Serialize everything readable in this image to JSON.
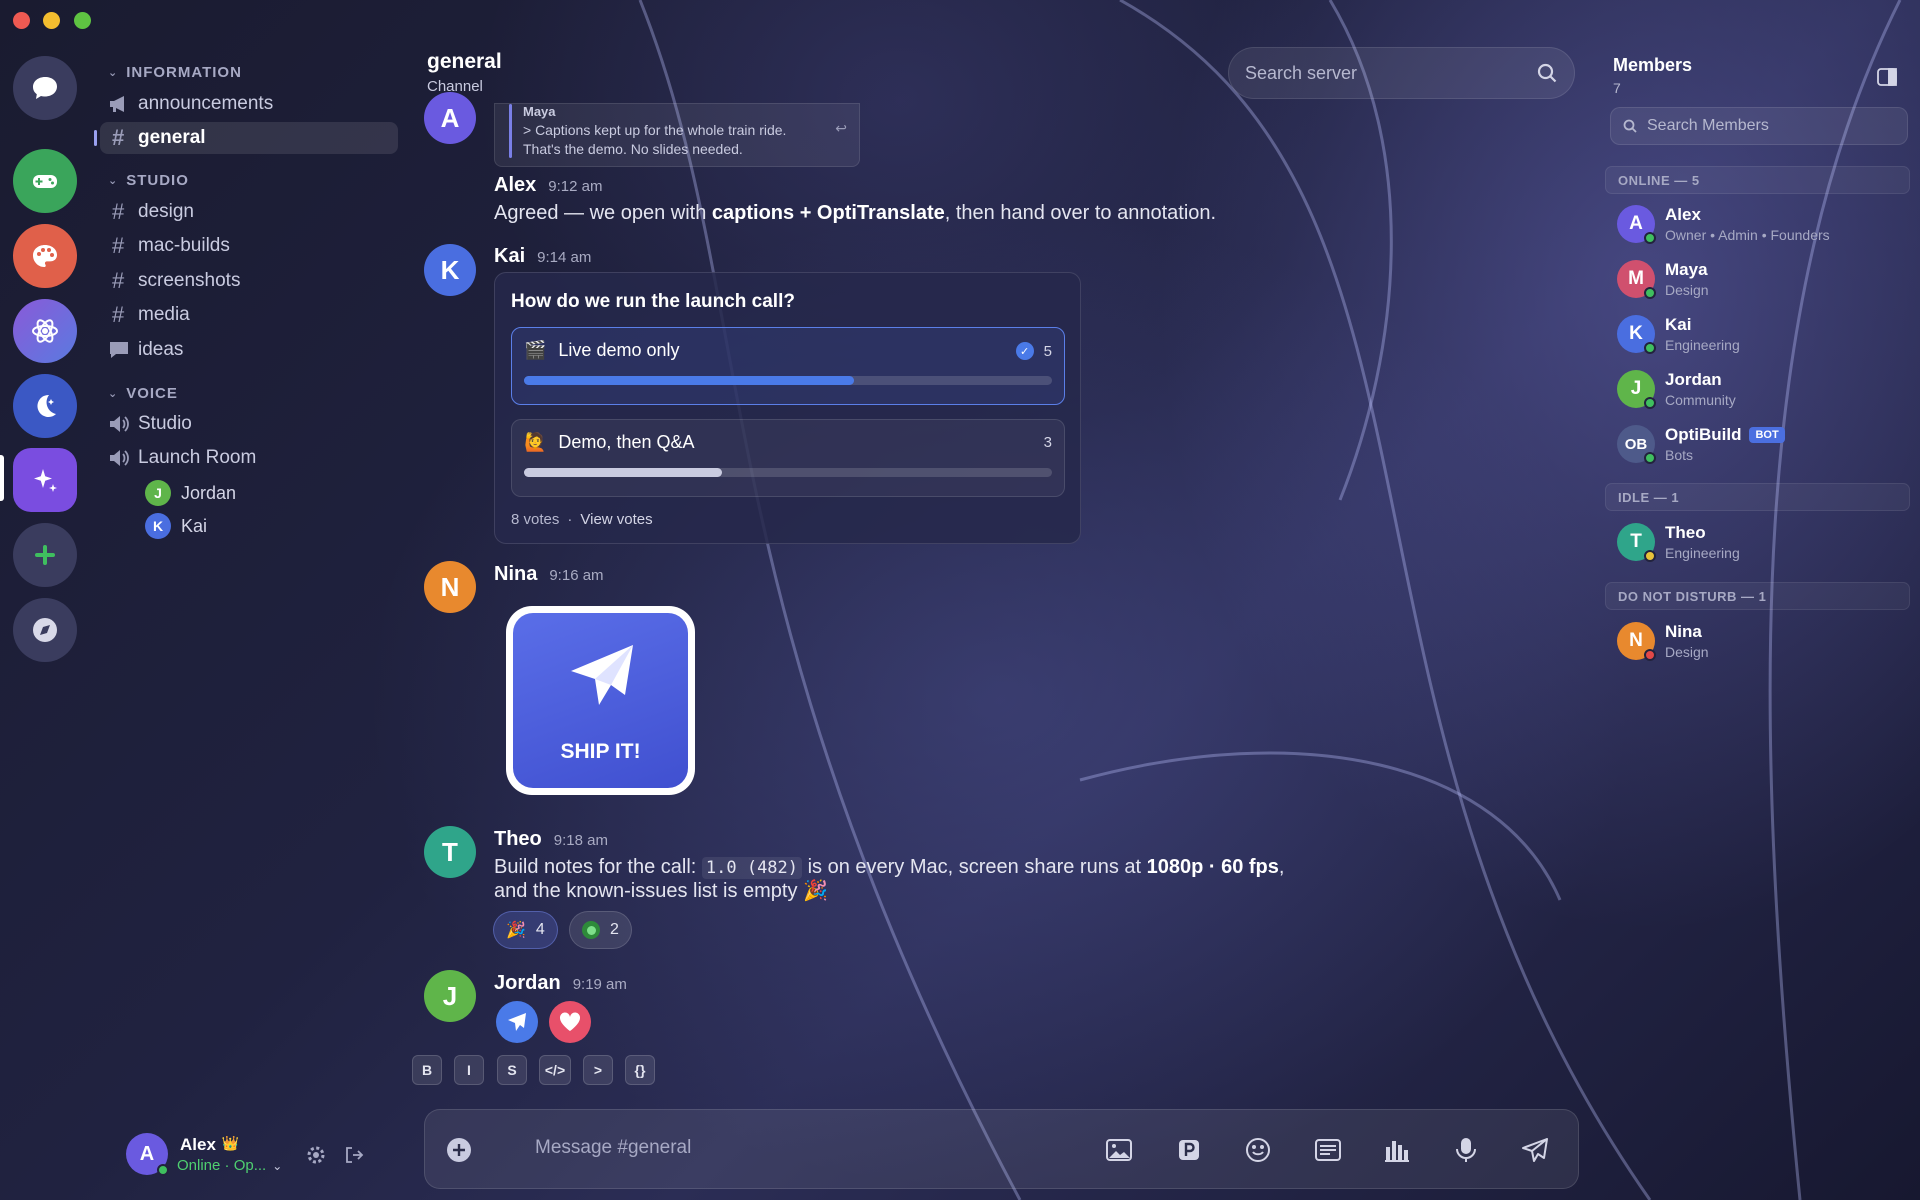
{
  "channel_list": {
    "sections": [
      {
        "label": "INFORMATION"
      },
      {
        "label": "STUDIO"
      },
      {
        "label": "VOICE"
      }
    ],
    "info_channels": [
      "announcements",
      "general"
    ],
    "studio_channels": [
      "design",
      "mac-builds",
      "screenshots",
      "media",
      "ideas"
    ],
    "voice_channels": [
      "Studio",
      "Launch Room"
    ],
    "voice_users": [
      {
        "initial": "J",
        "name": "Jordan",
        "color": "#5fb54a"
      },
      {
        "initial": "K",
        "name": "Kai",
        "color": "#4a6ee0"
      }
    ]
  },
  "user_panel": {
    "initial": "A",
    "name": "Alex",
    "status": "Online · Op...",
    "crown": "👑"
  },
  "header": {
    "title": "general",
    "subtitle": "Channel",
    "search_placeholder": "Search server"
  },
  "messages": {
    "quote": {
      "initial": "A",
      "author": "Maya",
      "line1": "> Captions kept up for the whole train ride.",
      "line2": "That's the demo. No slides needed."
    },
    "alex": {
      "name": "Alex",
      "time": "9:12 am",
      "text_pre": "Agreed — we open with ",
      "text_bold": "captions + OptiTranslate",
      "text_post": ", then hand over to annotation."
    },
    "kai": {
      "initial": "K",
      "name": "Kai",
      "time": "9:14 am"
    },
    "poll": {
      "question": "How do we run the launch call?",
      "options": [
        {
          "emoji": "🎬",
          "label": "Live demo only",
          "count": "5",
          "fraction": 0.625
        },
        {
          "emoji": "🙋",
          "label": "Demo, then Q&A",
          "count": "3",
          "fraction": 0.375
        }
      ],
      "votes": "8 votes",
      "sep": "·",
      "view": "View votes"
    },
    "nina": {
      "initial": "N",
      "name": "Nina",
      "time": "9:16 am",
      "sticker_text": "SHIP IT!"
    },
    "theo": {
      "initial": "T",
      "name": "Theo",
      "time": "9:18 am",
      "t1": "Build notes for the call: ",
      "code": "1.0 (482)",
      "t2": " is on every Mac, screen share runs at ",
      "bold": "1080p · 60 fps",
      "t3": ",",
      "line2": "and the known-issues list is empty 🎉",
      "reactions": [
        {
          "emoji": "🎉",
          "count": "4"
        },
        {
          "emoji": "🟢",
          "count": "2"
        }
      ]
    },
    "jordan": {
      "initial": "J",
      "name": "Jordan",
      "time": "9:19 am"
    }
  },
  "format_bar": [
    "B",
    "I",
    "S",
    "</>",
    ">",
    "{}"
  ],
  "composer": {
    "placeholder": "Message #general"
  },
  "members": {
    "title": "Members",
    "count": "7",
    "search_placeholder": "Search Members",
    "groups": [
      {
        "label": "ONLINE — 5"
      },
      {
        "label": "IDLE — 1"
      },
      {
        "label": "DO NOT DISTURB — 1"
      }
    ],
    "list": [
      {
        "initial": "A",
        "name": "Alex",
        "role": "Owner • Admin • Founders",
        "color": "#6a5ae0",
        "status": "#3fbf5f"
      },
      {
        "initial": "M",
        "name": "Maya",
        "role": "Design",
        "color": "#d0506e",
        "status": "#3fbf5f"
      },
      {
        "initial": "K",
        "name": "Kai",
        "role": "Engineering",
        "color": "#4a6ee0",
        "status": "#3fbf5f"
      },
      {
        "initial": "J",
        "name": "Jordan",
        "role": "Community",
        "color": "#5fb54a",
        "status": "#3fbf5f"
      },
      {
        "initial": "OB",
        "name": "OptiBuild",
        "role": "Bots",
        "color": "#4e5a8a",
        "status": "#3fbf5f",
        "badge": "BOT"
      },
      {
        "initial": "T",
        "name": "Theo",
        "role": "Engineering",
        "color": "#2fa58a",
        "status": "#e8c23a"
      },
      {
        "initial": "N",
        "name": "Nina",
        "role": "Design",
        "color": "#e8892e",
        "status": "#e24848"
      }
    ]
  }
}
